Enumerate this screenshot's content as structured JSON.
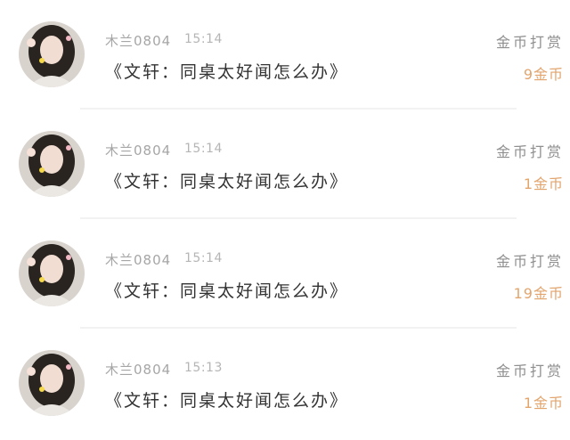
{
  "colors": {
    "username": "#a6a6a6",
    "time": "#b5b5b5",
    "message": "#333333",
    "reward_label": "#8f8f8f",
    "reward_amount": "#e2a56e"
  },
  "icons": {
    "avatar": "user-avatar-photo"
  },
  "reward_list": [
    {
      "username": "木兰0804",
      "time": "15:14",
      "message": "《文轩：同桌太好闻怎么办》",
      "reward_label": "金币打赏",
      "amount": "9金币"
    },
    {
      "username": "木兰0804",
      "time": "15:14",
      "message": "《文轩：同桌太好闻怎么办》",
      "reward_label": "金币打赏",
      "amount": "1金币"
    },
    {
      "username": "木兰0804",
      "time": "15:14",
      "message": "《文轩：同桌太好闻怎么办》",
      "reward_label": "金币打赏",
      "amount": "19金币"
    },
    {
      "username": "木兰0804",
      "time": "15:13",
      "message": "《文轩：同桌太好闻怎么办》",
      "reward_label": "金币打赏",
      "amount": "1金币"
    }
  ]
}
